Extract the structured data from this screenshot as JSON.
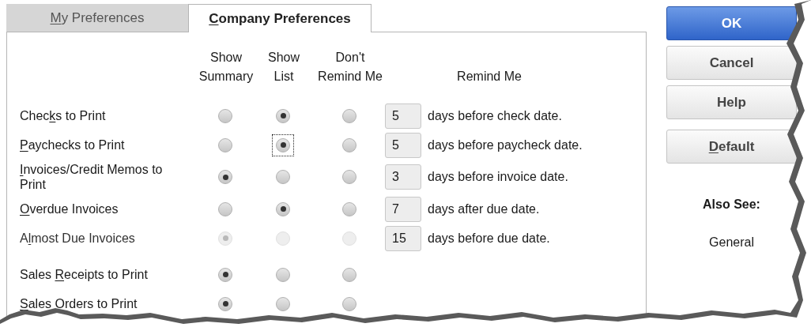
{
  "tabs": [
    {
      "label": [
        {
          "text": "M",
          "underlined": true
        },
        {
          "text": "y Preferences",
          "underlined": false
        }
      ],
      "selected": false
    },
    {
      "label": [
        {
          "text": "C",
          "underlined": true
        },
        {
          "text": "ompany Preferences",
          "underlined": false
        }
      ],
      "selected": true
    }
  ],
  "columns": [
    {
      "line1": "Show",
      "line2": "Summary"
    },
    {
      "line1": "Show",
      "line2": "List"
    },
    {
      "line1": "Don't",
      "line2": "Remind Me"
    }
  ],
  "remind_header": "Remind Me",
  "rows": [
    {
      "label": [
        {
          "text": "Chec",
          "underlined": false
        },
        {
          "text": "k",
          "underlined": true
        },
        {
          "text": "s to Print",
          "underlined": false
        }
      ],
      "disabled": false,
      "options": [
        {
          "selected": false,
          "focused": false
        },
        {
          "selected": true,
          "focused": false
        },
        {
          "selected": false,
          "focused": false
        }
      ],
      "days": "5",
      "note": "days before check date."
    },
    {
      "label": [
        {
          "text": "P",
          "underlined": true
        },
        {
          "text": "aychecks to Print",
          "underlined": false
        }
      ],
      "disabled": false,
      "options": [
        {
          "selected": false,
          "focused": false
        },
        {
          "selected": true,
          "focused": true
        },
        {
          "selected": false,
          "focused": false
        }
      ],
      "days": "5",
      "note": "days before paycheck date."
    },
    {
      "label": [
        {
          "text": "I",
          "underlined": true
        },
        {
          "text": "nvoices/Credit Memos to Print",
          "underlined": false
        }
      ],
      "disabled": false,
      "options": [
        {
          "selected": true,
          "focused": false
        },
        {
          "selected": false,
          "focused": false
        },
        {
          "selected": false,
          "focused": false
        }
      ],
      "days": "3",
      "note": "days before invoice date."
    },
    {
      "label": [
        {
          "text": "O",
          "underlined": true
        },
        {
          "text": "verdue Invoices",
          "underlined": false
        }
      ],
      "disabled": false,
      "options": [
        {
          "selected": false,
          "focused": false
        },
        {
          "selected": true,
          "focused": false
        },
        {
          "selected": false,
          "focused": false
        }
      ],
      "days": "7",
      "note": "days after due date."
    },
    {
      "label": [
        {
          "text": "A",
          "underlined": false
        },
        {
          "text": "l",
          "underlined": true
        },
        {
          "text": "most Due Invoices",
          "underlined": false
        }
      ],
      "disabled": true,
      "options": [
        {
          "selected": true,
          "focused": false
        },
        {
          "selected": false,
          "focused": false
        },
        {
          "selected": false,
          "focused": false
        }
      ],
      "days": "15",
      "note": "days before due date."
    },
    {
      "label": [
        {
          "text": "Sales ",
          "underlined": false
        },
        {
          "text": "R",
          "underlined": true
        },
        {
          "text": "eceipts to Print",
          "underlined": false
        }
      ],
      "disabled": false,
      "options": [
        {
          "selected": true,
          "focused": false
        },
        {
          "selected": false,
          "focused": false
        },
        {
          "selected": false,
          "focused": false
        }
      ]
    },
    {
      "label": [
        {
          "text": "S",
          "underlined": true
        },
        {
          "text": "ales Orders to Print",
          "underlined": false
        }
      ],
      "disabled": false,
      "options": [
        {
          "selected": true,
          "focused": false
        },
        {
          "selected": false,
          "focused": false
        },
        {
          "selected": false,
          "focused": false
        }
      ]
    }
  ],
  "buttons": [
    {
      "kind": "primary",
      "label": [
        {
          "text": "OK",
          "underlined": false
        }
      ]
    },
    {
      "kind": "normal",
      "label": [
        {
          "text": "Cancel",
          "underlined": false
        }
      ]
    },
    {
      "kind": "normal",
      "label": [
        {
          "text": "Help",
          "underlined": false
        }
      ]
    },
    {
      "kind": "gap",
      "label": [
        {
          "text": "D",
          "underlined": true
        },
        {
          "text": "efault",
          "underlined": false
        }
      ]
    }
  ],
  "also_see": {
    "title": "Also See:",
    "links": [
      "General"
    ]
  }
}
